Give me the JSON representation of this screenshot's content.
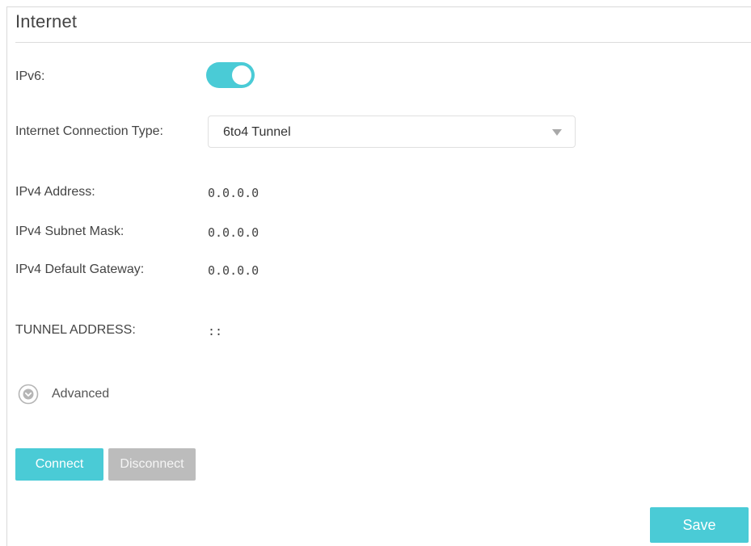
{
  "page": {
    "title": "Internet"
  },
  "ipv6": {
    "label": "IPv6:",
    "enabled": true
  },
  "connection_type": {
    "label": "Internet Connection Type:",
    "selected": "6to4 Tunnel"
  },
  "ipv4_address": {
    "label": "IPv4 Address:",
    "value": "0.0.0.0"
  },
  "ipv4_subnet_mask": {
    "label": "IPv4 Subnet Mask:",
    "value": "0.0.0.0"
  },
  "ipv4_default_gateway": {
    "label": "IPv4 Default Gateway:",
    "value": "0.0.0.0"
  },
  "tunnel_address": {
    "label": "TUNNEL ADDRESS:",
    "value": "::"
  },
  "advanced": {
    "label": "Advanced",
    "icon": "chevron-down-circle-icon"
  },
  "actions": {
    "connect_label": "Connect",
    "disconnect_label": "Disconnect",
    "save_label": "Save"
  },
  "colors": {
    "accent": "#4acbd6",
    "disabled_button": "#bcbcbc"
  }
}
